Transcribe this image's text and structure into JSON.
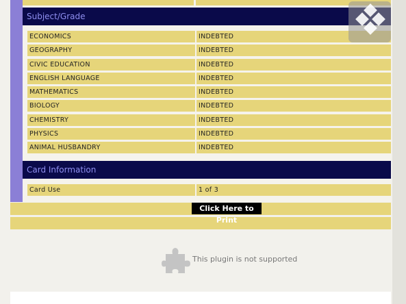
{
  "subject_section": {
    "title": "Subject/Grade",
    "rows": [
      {
        "subject": "ECONOMICS",
        "grade": "INDEBTED"
      },
      {
        "subject": "GEOGRAPHY",
        "grade": "INDEBTED"
      },
      {
        "subject": "CIVIC EDUCATION",
        "grade": "INDEBTED"
      },
      {
        "subject": "ENGLISH LANGUAGE",
        "grade": "INDEBTED"
      },
      {
        "subject": "MATHEMATICS",
        "grade": "INDEBTED"
      },
      {
        "subject": "BIOLOGY",
        "grade": "INDEBTED"
      },
      {
        "subject": "CHEMISTRY",
        "grade": "INDEBTED"
      },
      {
        "subject": "PHYSICS",
        "grade": "INDEBTED"
      },
      {
        "subject": "ANIMAL HUSBANDRY",
        "grade": "INDEBTED"
      }
    ]
  },
  "card_section": {
    "title": "Card Information",
    "card_use_label": "Card Use",
    "card_use_value": "1 of 3"
  },
  "print_button": {
    "label": "Click Here to Print"
  },
  "plugin": {
    "message": "This plugin is not supported",
    "icon": "puzzle-piece-icon"
  },
  "overlay": {
    "icon": "diamond-grid-icon"
  },
  "colors": {
    "header_bg": "#0a0a4a",
    "header_text": "#8f8ff0",
    "cell_bg": "#e6d57a",
    "accent_bar": "#8b7fd6"
  }
}
